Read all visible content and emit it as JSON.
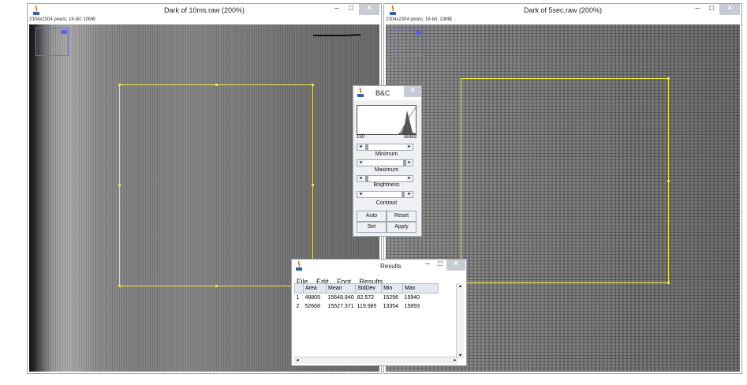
{
  "colors": {
    "roi": "#e8e840",
    "title_bar": "#ffffff",
    "close_button": "#c7ccd4"
  },
  "left_window": {
    "title": "Dark of 10ms.raw (200%)",
    "info": "2304x2304 pixels; 16-bit; 10MB",
    "minimize": "–",
    "maximize": "□",
    "close": "×"
  },
  "right_window": {
    "title": "Dark of 5sec.raw (200%)",
    "info": "2304x2304 pixels; 16-bit; 10MB",
    "minimize": "–",
    "maximize": "□",
    "close": "×"
  },
  "bc_window": {
    "title": "B&C",
    "close": "×",
    "hist_min": "150",
    "hist_max": "16383",
    "labels": {
      "minimum": "Minimum",
      "maximum": "Maximum",
      "brightness": "Brightness",
      "contrast": "Contrast"
    },
    "buttons": {
      "auto": "Auto",
      "reset": "Reset",
      "set": "Set",
      "apply": "Apply"
    }
  },
  "results_window": {
    "title": "Results",
    "minimize": "–",
    "maximize": "□",
    "close": "×",
    "menu": [
      "File",
      "Edit",
      "Font",
      "Results"
    ],
    "columns": [
      "",
      "Area",
      "Mean",
      "StdDev",
      "Min",
      "Max"
    ],
    "rows": [
      [
        "1",
        "48805",
        "15648.940",
        "82.572",
        "15296",
        "15940"
      ],
      [
        "2",
        "52668",
        "15527.371",
        "119.985",
        "13354",
        "15893"
      ]
    ]
  }
}
